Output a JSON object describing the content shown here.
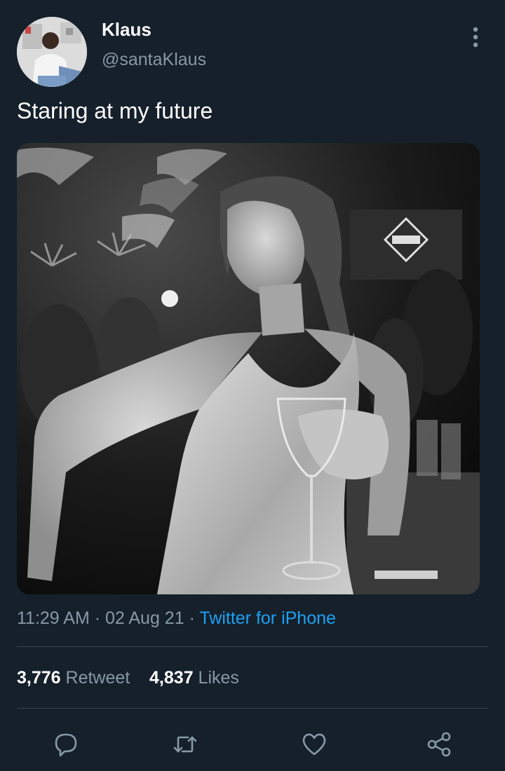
{
  "tweet": {
    "author": {
      "display_name": "Klaus",
      "handle": "@santaKlaus",
      "avatar": "profile-photo"
    },
    "text": "Staring at my future",
    "media": {
      "type": "photo",
      "description_icon": "photo"
    },
    "meta": {
      "time": "11:29 AM",
      "separator1": " · ",
      "date": "02 Aug 21",
      "separator2": " · ",
      "source": "Twitter for iPhone"
    },
    "stats": {
      "retweets_count": "3,776",
      "retweets_label": "Retweet",
      "likes_count": "4,837",
      "likes_label": "Likes"
    }
  },
  "actions": [
    "reply-icon",
    "retweet-icon",
    "like-icon",
    "share-icon"
  ],
  "colors": {
    "background": "#15202b",
    "secondary_text": "#8899a6",
    "accent": "#1da1f2",
    "divider": "#38444d"
  }
}
